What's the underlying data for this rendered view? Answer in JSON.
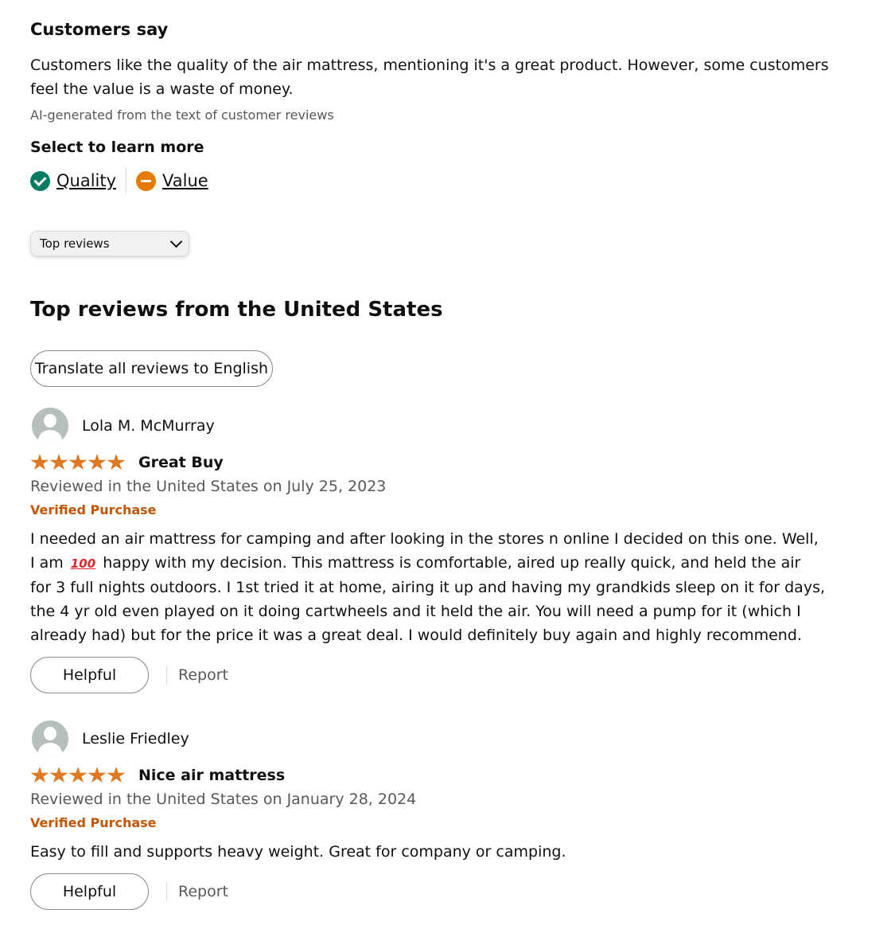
{
  "summary_section": {
    "heading": "Customers say",
    "summary_text": "Customers like the quality of the air mattress, mentioning it's a great product. However, some customers feel the value is a waste of money.",
    "ai_note": "AI-generated from the text of customer reviews",
    "select_heading": "Select to learn more",
    "aspects": [
      {
        "label": "Quality",
        "sentiment": "positive",
        "icon": "check-circle-icon",
        "color": "#067d62"
      },
      {
        "label": "Value",
        "sentiment": "negative",
        "icon": "minus-circle-icon",
        "color": "#e67a00"
      }
    ]
  },
  "sort": {
    "selected": "Top reviews"
  },
  "reviews_section": {
    "heading": "Top reviews from the United States",
    "translate_label": "Translate all reviews to English"
  },
  "reviews": [
    {
      "author": "Lola M. McMurray",
      "rating": 5,
      "title": "Great Buy",
      "date_text": "Reviewed in the United States on July 25, 2023",
      "verified_label": "Verified Purchase",
      "body_before_emoji": "I needed an air mattress for camping and after looking in the stores n online I decided on this one. Well, I am",
      "emoji": "100",
      "body_after_emoji": "happy with my decision. This mattress is comfortable, aired up really quick, and held the air for 3 full nights outdoors. I 1st tried it at home, airing it up and having my grandkids sleep on it for days, the 4 yr old even played on it doing cartwheels and it held the air. You will need a pump for it (which I already had) but for the price it was a great deal. I would definitely buy again and highly recommend.",
      "helpful_label": "Helpful",
      "report_label": "Report"
    },
    {
      "author": "Leslie Friedley",
      "rating": 5,
      "title": "Nice air mattress",
      "date_text": "Reviewed in the United States on January 28, 2024",
      "verified_label": "Verified Purchase",
      "body": "Easy to fill and supports heavy weight. Great for company or camping.",
      "helpful_label": "Helpful",
      "report_label": "Report"
    }
  ],
  "colors": {
    "star": "#de7921",
    "verified": "#c45500",
    "secondary_text": "#565959"
  }
}
